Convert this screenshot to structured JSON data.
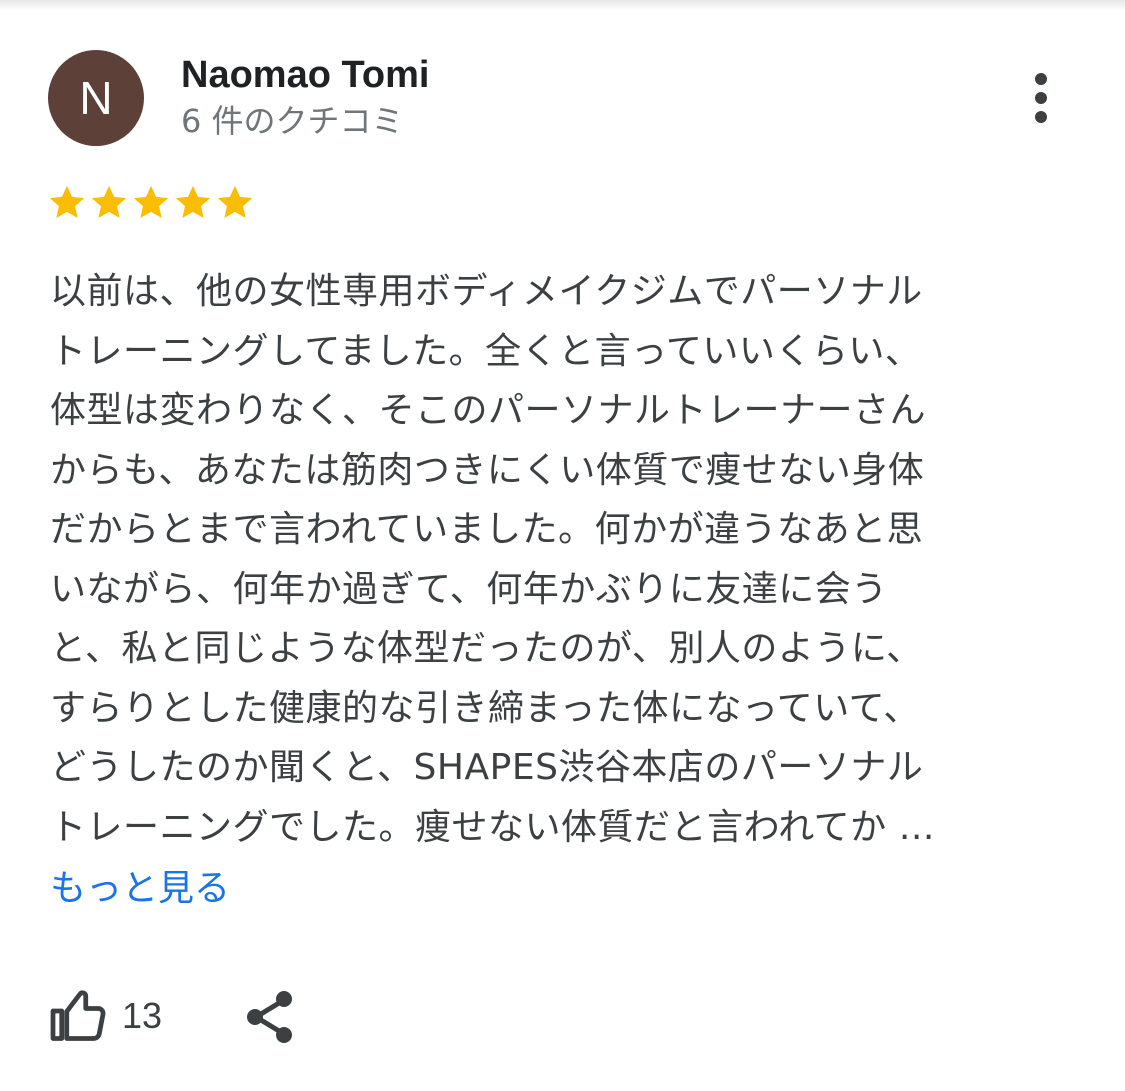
{
  "review": {
    "author": {
      "initial": "N",
      "name": "Naomao Tomi",
      "review_count": "6 件のクチコミ",
      "avatar_color": "#5d4037"
    },
    "rating": 5,
    "max_rating": 5,
    "star_color": "#fbbc04",
    "text_lines": [
      "以前は、他の女性専用ボディメイクジムでパーソナル",
      "トレーニングしてました。全くと言っていいくらい、",
      "体型は変わりなく、そこのパーソナルトレーナーさん",
      "からも、あなたは筋肉つきにくい体質で痩せない身体",
      "だからとまで言われていました。何かが違うなあと思",
      "いながら、何年か過ぎて、何年かぶりに友達に会う",
      "と、私と同じような体型だったのが、別人のように、",
      "すらりとした健康的な引き締まった体になっていて、",
      "どうしたのか聞くと、SHAPES渋谷本店のパーソナル",
      "トレーニングでした。痩せない体質だと言われてか …"
    ],
    "show_more_label": "もっと見る",
    "link_color": "#1a73e8",
    "like_count": "13",
    "icons": {
      "menu": "more-vertical-icon",
      "like": "thumb-up-icon",
      "share": "share-icon",
      "star": "star-icon"
    }
  }
}
